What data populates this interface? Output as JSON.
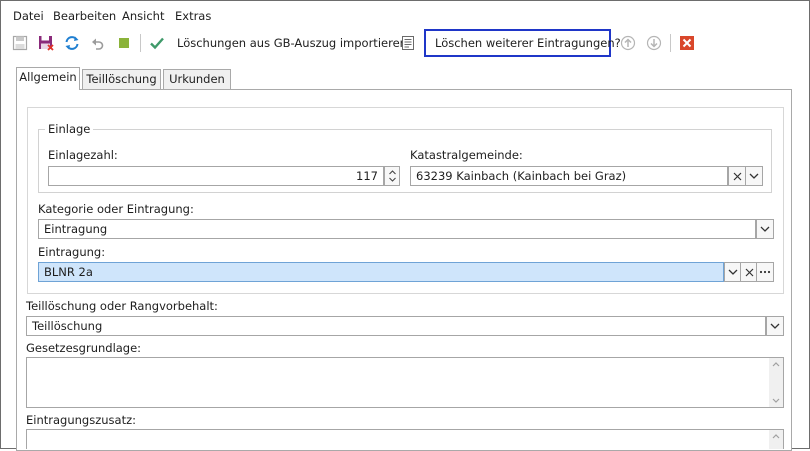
{
  "menu": {
    "items": [
      "Datei",
      "Bearbeiten",
      "Ansicht",
      "Extras"
    ]
  },
  "toolbar": {
    "import_label": "Löschungen aus GB-Auszug importieren",
    "delete_further_label": "Löschen weiterer Eintragungen?"
  },
  "tabs": [
    "Allgemein",
    "Teillöschung",
    "Urkunden"
  ],
  "einlage": {
    "group_title": "Einlage",
    "einlagezahl_label": "Einlagezahl:",
    "einlagezahl_value": "117",
    "katastral_label": "Katastralgemeinde:",
    "katastral_value": "63239 Kainbach (Kainbach bei Graz)"
  },
  "kategorie": {
    "label": "Kategorie oder Eintragung:",
    "value": "Eintragung"
  },
  "eintragung": {
    "label": "Eintragung:",
    "value": "BLNR  2a"
  },
  "teilloeschung": {
    "label": "Teillöschung oder Rangvorbehalt:",
    "value": "Teillöschung"
  },
  "gesetz": {
    "label": "Gesetzesgrundlage:",
    "value": ""
  },
  "zusatz": {
    "label": "Eintragungszusatz:",
    "value": ""
  },
  "colors": {
    "accent_blue": "#1f36c8",
    "selection_bg": "#cfe5fb",
    "save_purple": "#8a2a7a",
    "refresh_blue": "#1f7fd1",
    "green_square": "#8bb33a",
    "check_green": "#3f9a6a",
    "close_red": "#d9472b"
  },
  "icons": [
    "save-icon",
    "save-close-icon",
    "refresh-icon",
    "undo-icon",
    "green-square-icon",
    "check-icon",
    "document-list-icon",
    "arrow-up-circle-icon",
    "arrow-down-circle-icon",
    "close-icon"
  ]
}
